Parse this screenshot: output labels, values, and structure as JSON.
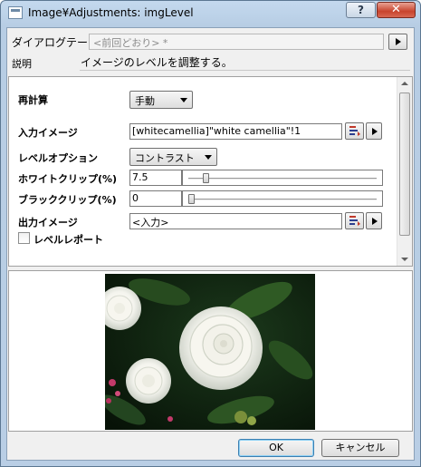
{
  "window": {
    "title": "Image¥Adjustments: imgLevel",
    "help_label": "?",
    "close_label": "✕"
  },
  "header": {
    "theme_label": "ダイアログテーマ",
    "theme_value": "<前回どおり> *",
    "description_label": "説明",
    "description_text": "イメージのレベルを調整する。"
  },
  "settings": {
    "recalc": {
      "label": "再計算",
      "value": "手動"
    },
    "input_image": {
      "label": "入力イメージ",
      "value": "[whitecamellia]\"white camellia\"!1"
    },
    "level_option": {
      "label": "レベルオプション",
      "value": "コントラスト"
    },
    "white_clip": {
      "label": "ホワイトクリップ(%)",
      "value": "7.5",
      "slider_fraction": 0.08
    },
    "black_clip": {
      "label": "ブラッククリップ(%)",
      "value": "0",
      "slider_fraction": 0.0
    },
    "output_image": {
      "label": "出力イメージ",
      "value": "<入力>"
    },
    "level_report": {
      "label": "レベルレポート",
      "checked": false
    }
  },
  "buttons": {
    "ok": "OK",
    "cancel": "キャンセル"
  },
  "colors": {
    "title_gradient": "#c4d9ee",
    "close_red": "#c8432d",
    "default_button_border": "#3c7fb1"
  }
}
